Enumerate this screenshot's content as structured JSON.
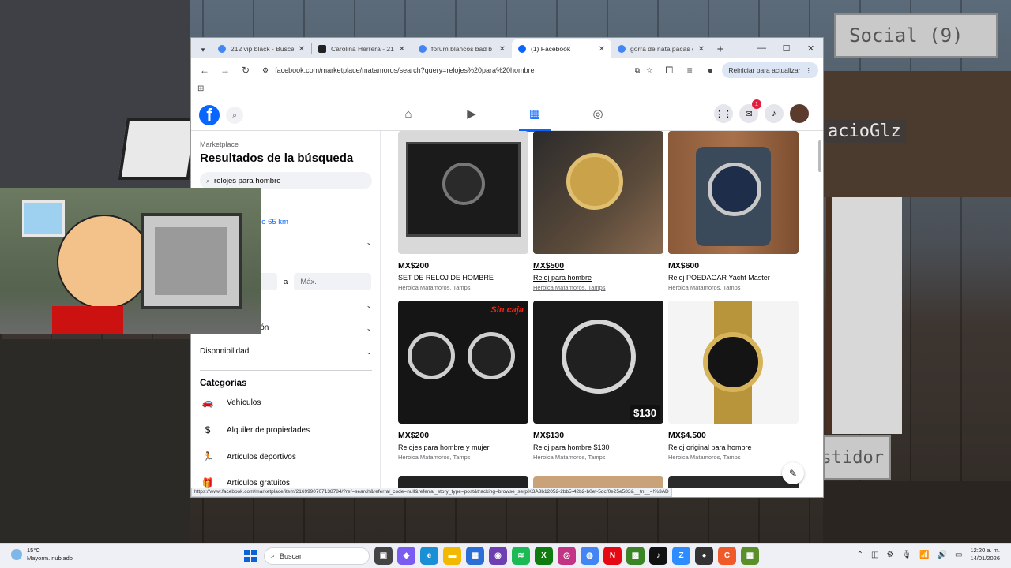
{
  "overlay": {
    "social_label": "Social (9)",
    "player_tag": "acioGlz",
    "server_label": "stidor"
  },
  "browser": {
    "tabs": [
      {
        "title": "212 vip black - Busca",
        "favicon": "google-icon",
        "color": "#4285f4",
        "active": false
      },
      {
        "title": "Carolina Herrera - 21",
        "favicon": "amazon-icon",
        "color": "#222222",
        "active": false
      },
      {
        "title": "forum blancos bad b",
        "favicon": "google-icon",
        "color": "#4285f4",
        "active": false
      },
      {
        "title": "(1) Facebook",
        "favicon": "facebook-icon",
        "color": "#0866ff",
        "active": true
      },
      {
        "title": "gorra de nata pacas d",
        "favicon": "google-icon",
        "color": "#4285f4",
        "active": false
      }
    ],
    "url": "facebook.com/marketplace/matamoros/search?query=relojes%20para%20hombre",
    "update_label": "Reiniciar para actualizar",
    "status_url": "https://www.facebook.com/marketplace/item/2169990707138784/?ref=search&referral_code=null&referral_story_type=post&tracking=browse_serp%3A3b12052-2bb5-42b2-b0ef-5dcf0e25e583&__tn__=!%3AD"
  },
  "facebook": {
    "messenger_badge": "1",
    "sidebar": {
      "breadcrumb": "Marketplace",
      "title": "Resultados de la búsqueda",
      "search_value": "relojes para hombre",
      "location": "ros · En un radio de 65 km",
      "price_separator": "a",
      "price_max_placeholder": "Máx.",
      "filter_partial": "ción",
      "availability": "Disponibilidad",
      "categories_title": "Categorías",
      "categories": [
        {
          "label": "Vehículos",
          "icon": "car-icon"
        },
        {
          "label": "Alquiler de propiedades",
          "icon": "house-dollar-icon"
        },
        {
          "label": "Artículos deportivos",
          "icon": "running-icon"
        },
        {
          "label": "Artículos gratuitos",
          "icon": "gift-icon"
        }
      ]
    },
    "listings": [
      {
        "price": "MX$200",
        "title": "SET DE RELOJ DE HOMBRE",
        "location": "Heroica Matamoros, Tamps"
      },
      {
        "price": "MX$500",
        "title": "Reloj para hombre",
        "location": "Heroica Matamoros, Tamps"
      },
      {
        "price": "MX$600",
        "title": "Reloj POEDAGAR Yacht Master",
        "location": "Heroica Matamoros, Tamps"
      },
      {
        "price": "MX$200",
        "title": "Relojes para hombre y mujer",
        "location": "Heroica Matamoros, Tamps",
        "overlay": "Sin caja"
      },
      {
        "price": "MX$130",
        "title": "Reloj para hombre $130",
        "location": "Heroica Matamoros, Tamps",
        "overlay": "$130"
      },
      {
        "price": "MX$4.500",
        "title": "Reloj original para hombre",
        "location": "Heroica Matamoros, Tamps"
      }
    ]
  },
  "taskbar": {
    "temperature": "15°C",
    "weather": "Mayorm. nublado",
    "search_placeholder": "Buscar",
    "time": "12:20 a. m.",
    "date": "14/01/2026"
  }
}
